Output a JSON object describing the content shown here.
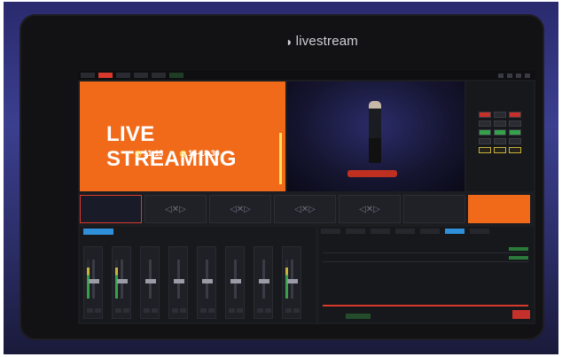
{
  "brand": {
    "name": "livestream",
    "mark_icon": "livestream-mark-icon"
  },
  "preview": {
    "title": "LIVE STREAMING",
    "times": [
      "11-13",
      "15-18.30"
    ],
    "clock_icon": "clock-icon"
  },
  "colors": {
    "accent_red": "#d8392b",
    "preview_orange": "#f06a1a",
    "active_blue": "#2f8fd8",
    "ok_green": "#36a14a"
  }
}
